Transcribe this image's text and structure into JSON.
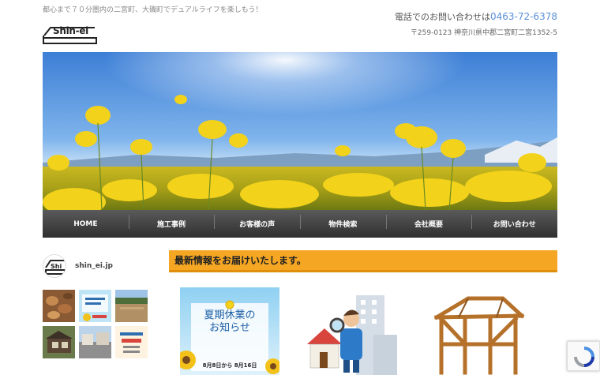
{
  "header": {
    "tagline": "都心まで７０分圏内の二宮町、大磯町でデュアルライフを楽しもう！",
    "logo_text": "Shin-ei",
    "phone_label": "電話でのお問い合わせは",
    "phone_number": "0463-72-6378",
    "address": "〒259-0123 神奈川県中郡二宮町二宮1352-5"
  },
  "nav": {
    "items": [
      {
        "label": "HOME"
      },
      {
        "label": "施工事例"
      },
      {
        "label": "お客様の声"
      },
      {
        "label": "物件検索"
      },
      {
        "label": "会社概要"
      },
      {
        "label": "お問い合わせ"
      }
    ]
  },
  "instagram": {
    "username": "shin_ei.jp"
  },
  "news": {
    "heading": "最新情報をお届けいたします。"
  },
  "cards": {
    "summer": {
      "small_top": "お知らせ",
      "title_line1": "夏期休業の",
      "title_line2": "お知らせ",
      "dates": "8月8日から 8月16日"
    }
  },
  "colors": {
    "accent_orange": "#f5a623",
    "nav_dark": "#3a3a3a",
    "phone_blue": "#5a8fd8"
  }
}
